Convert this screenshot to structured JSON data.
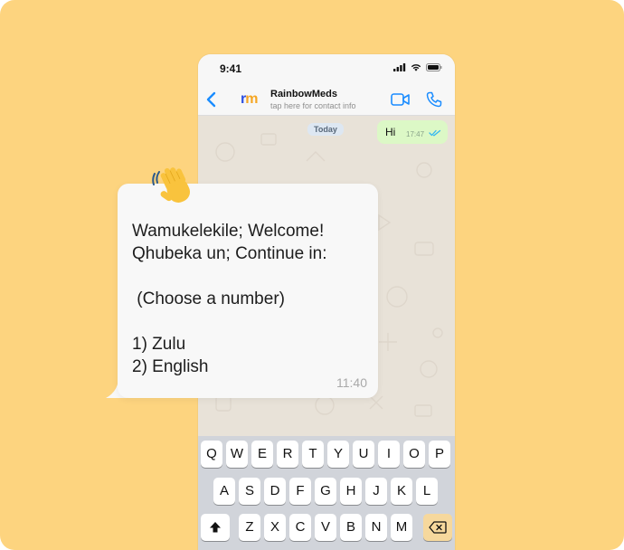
{
  "status": {
    "time": "9:41"
  },
  "header": {
    "logo_r": "r",
    "logo_m": "m",
    "contact_name": "RainbowMeds",
    "contact_sub": "tap here for contact info"
  },
  "chat": {
    "date_pill": "Today",
    "outgoing": {
      "text": "Hi",
      "time": "17:47"
    },
    "incoming": {
      "text": "Wamukelekile; Welcome!\nQhubeka un; Continue in:\n\n (Choose a number)\n\n1) Zulu\n2) English",
      "time": "11:40"
    }
  },
  "keyboard": {
    "row1": [
      "Q",
      "W",
      "E",
      "R",
      "T",
      "Y",
      "U",
      "I",
      "O",
      "P"
    ],
    "row2": [
      "A",
      "S",
      "D",
      "F",
      "G",
      "H",
      "J",
      "K",
      "L"
    ],
    "row3": [
      "Z",
      "X",
      "C",
      "V",
      "B",
      "N",
      "M"
    ]
  },
  "colors": {
    "background": "#fdd47f",
    "accent": "#1a8cff",
    "outgoing_bubble": "#dcf8c6",
    "incoming_bubble": "#f8f8f8"
  },
  "icons": [
    "back-chevron-icon",
    "video-call-icon",
    "phone-call-icon",
    "signal-icon",
    "wifi-icon",
    "battery-icon",
    "read-ticks-icon",
    "waving-hand-icon",
    "shift-icon",
    "delete-icon"
  ]
}
